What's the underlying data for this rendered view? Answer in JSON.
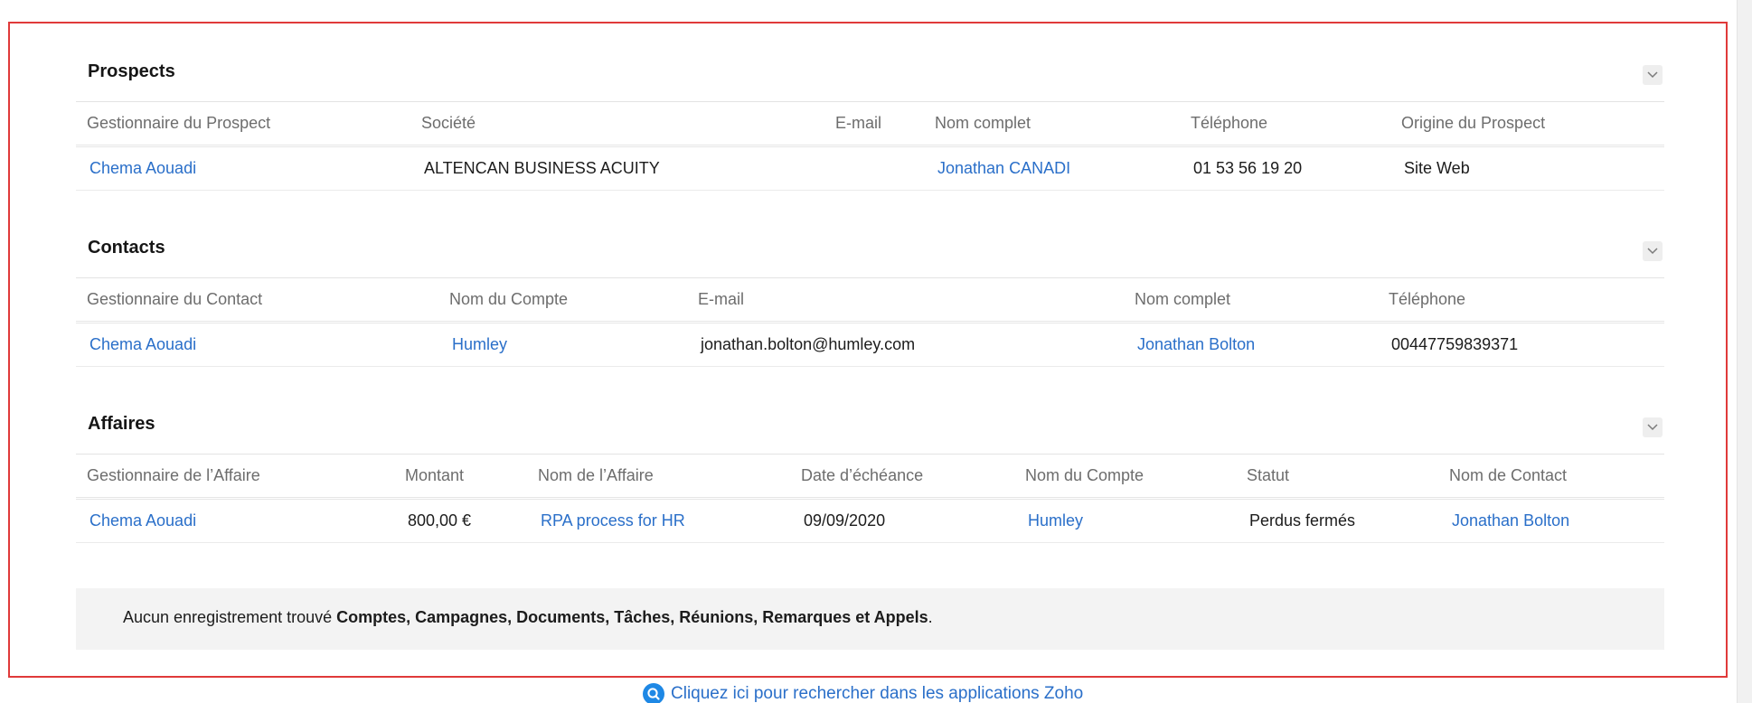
{
  "prospects": {
    "title": "Prospects",
    "columns": [
      "Gestionnaire du Prospect",
      "Société",
      "E-mail",
      "Nom complet",
      "Téléphone",
      "Origine du Prospect"
    ],
    "row": {
      "owner": "Chema Aouadi",
      "company": "ALTENCAN BUSINESS ACUITY",
      "email": "",
      "full_name": "Jonathan CANADI",
      "phone": "01 53 56 19 20",
      "source": "Site Web"
    }
  },
  "contacts": {
    "title": "Contacts",
    "columns": [
      "Gestionnaire du Contact",
      "Nom du Compte",
      "E-mail",
      "Nom complet",
      "Téléphone"
    ],
    "row": {
      "owner": "Chema Aouadi",
      "account": "Humley",
      "email": "jonathan.bolton@humley.com",
      "full_name": "Jonathan Bolton",
      "phone": "00447759839371"
    }
  },
  "deals": {
    "title": "Affaires",
    "columns": [
      "Gestionnaire de l’Affaire",
      "Montant",
      "Nom de l’Affaire",
      "Date d’échéance",
      "Nom du Compte",
      "Statut",
      "Nom de Contact"
    ],
    "row": {
      "owner": "Chema Aouadi",
      "amount": "800,00 €",
      "deal_name": "RPA process for HR",
      "closing_date": "09/09/2020",
      "account": "Humley",
      "stage": "Perdus fermés",
      "contact": "Jonathan Bolton"
    }
  },
  "no_records": {
    "prefix": "Aucun enregistrement trouvé ",
    "modules": "Comptes, Campagnes, Documents, Tâches, Réunions, Remarques et Appels",
    "suffix": "."
  },
  "zoho_search": {
    "label": "Cliquez ici pour rechercher dans les applications Zoho"
  },
  "colors": {
    "link": "#2a6fc9",
    "frame_border": "#e03a3a",
    "header_text": "#6d6d6d",
    "search_icon": "#1e88e5"
  },
  "icons": {
    "collapse": "chevron-down-icon",
    "search": "search-icon"
  }
}
